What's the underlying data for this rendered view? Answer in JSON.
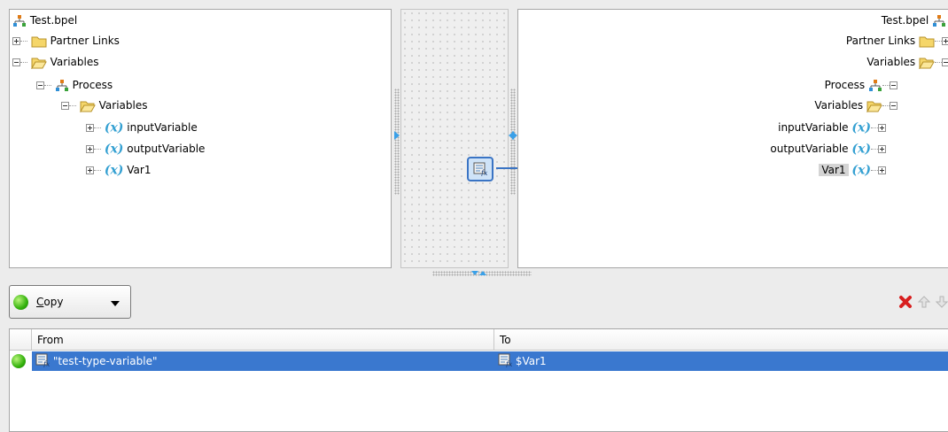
{
  "left_tree": {
    "root": "Test.bpel",
    "partner_links": "Partner Links",
    "variables": "Variables",
    "process": "Process",
    "process_variables": "Variables",
    "input_variable": "inputVariable",
    "output_variable": "outputVariable",
    "var1": "Var1",
    "var_symbol": "(x)"
  },
  "right_tree": {
    "root": "Test.bpel",
    "partner_links": "Partner Links",
    "variables": "Variables",
    "process": "Process",
    "process_variables": "Variables",
    "input_variable": "inputVariable",
    "output_variable": "outputVariable",
    "var1": "Var1",
    "var_symbol": "(x)"
  },
  "toolbar": {
    "operation": "Copy",
    "operation_mnemonic": "C",
    "operation_rest": "opy",
    "delete_icon": "delete-x-icon",
    "move_up_icon": "arrow-up-icon",
    "move_down_icon": "arrow-down-icon"
  },
  "table": {
    "columns": [
      "From",
      "To"
    ],
    "rows": [
      {
        "from": "\"test-type-variable\"",
        "to": "$Var1"
      }
    ]
  },
  "colors": {
    "selection": "#3a78cf",
    "link_line": "#3a74c4",
    "variable_icon": "#34a0d2",
    "status_green": "#33b10c",
    "delete_red": "#d81f1f"
  }
}
